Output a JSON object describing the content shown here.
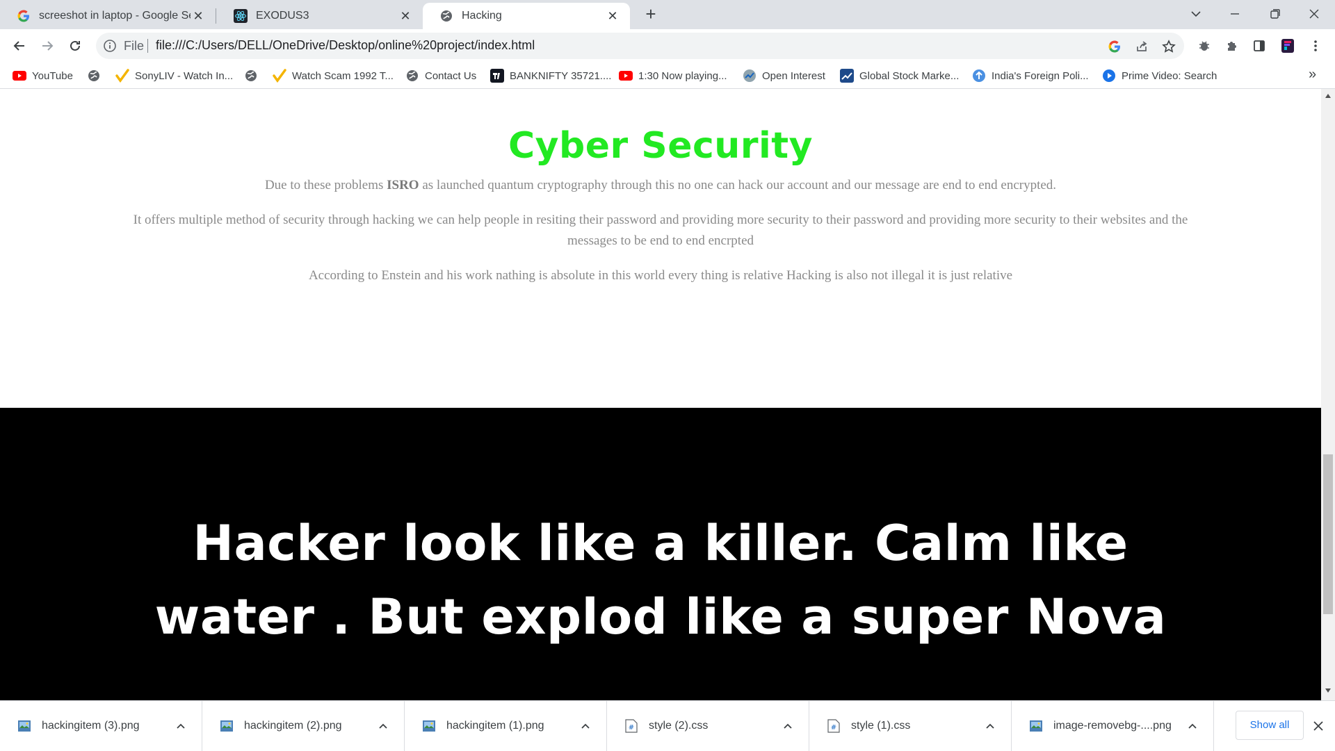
{
  "tabs": [
    {
      "title": "screeshot in laptop - Google Sear",
      "icon": "google-icon"
    },
    {
      "title": "EXODUS3",
      "icon": "react-icon"
    },
    {
      "title": "Hacking",
      "icon": "globe-icon"
    }
  ],
  "toolbar": {
    "scheme_label": "File",
    "url": "file:///C:/Users/DELL/OneDrive/Desktop/online%20project/index.html"
  },
  "bookmarks": [
    {
      "label": "YouTube",
      "icon": "youtube-icon"
    },
    {
      "label": "",
      "icon": "globe-icon"
    },
    {
      "label": "SonyLIV - Watch In...",
      "icon": "check-icon"
    },
    {
      "label": "",
      "icon": "globe-icon"
    },
    {
      "label": "Watch Scam 1992 T...",
      "icon": "check-icon"
    },
    {
      "label": "Contact Us",
      "icon": "globe-icon"
    },
    {
      "label": "BANKNIFTY 35721....",
      "icon": "tradingview-icon"
    },
    {
      "label": "1:30 Now playing...",
      "icon": "youtube-icon"
    },
    {
      "label": "Open Interest",
      "icon": "chart-icon"
    },
    {
      "label": "Global Stock Marke...",
      "icon": "stock-icon"
    },
    {
      "label": "India's Foreign Poli...",
      "icon": "upload-icon"
    },
    {
      "label": "Prime Video: Search",
      "icon": "play-icon"
    }
  ],
  "page": {
    "heading": "Cyber Security",
    "p1_before": "Due to these problems ",
    "p1_bold": "ISRO",
    "p1_after": " as launched quantum cryptography through this no one can hack our account and our message are end to end encrypted.",
    "p2": "It offers multiple method of security through hacking we can help people in resiting their password and providing more security to their password and providing more security to their websites and the messages to be end to end encrpted",
    "p3": "According to Enstein and his work nathing is absolute in this world every thing is relative Hacking is also not illegal it is just relative",
    "quote": "Hacker look like a killer. Calm like water . But explod like a super Nova"
  },
  "colors": {
    "heading": "#22e922",
    "paragraph": "#8a8a8a",
    "dark_band": "#000000",
    "quote": "#ffffff"
  },
  "downloads": {
    "items": [
      {
        "name": "hackingitem (3).png",
        "icon": "image-file-icon"
      },
      {
        "name": "hackingitem (2).png",
        "icon": "image-file-icon"
      },
      {
        "name": "hackingitem (1).png",
        "icon": "image-file-icon"
      },
      {
        "name": "style (2).css",
        "icon": "css-file-icon"
      },
      {
        "name": "style (1).css",
        "icon": "css-file-icon"
      },
      {
        "name": "image-removebg-....png",
        "icon": "image-file-icon"
      }
    ],
    "show_all_label": "Show all"
  }
}
